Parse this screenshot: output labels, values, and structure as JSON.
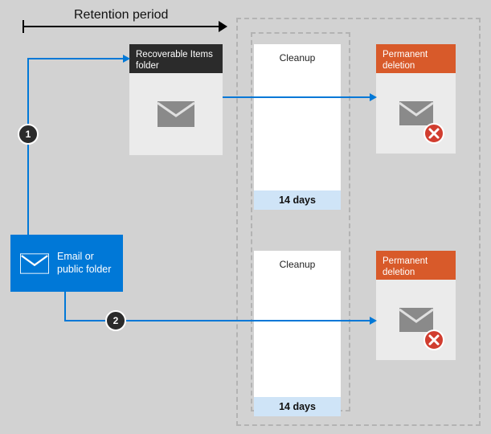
{
  "retentionPeriod": {
    "label": "Retention period"
  },
  "source": {
    "label": "Email or public folder"
  },
  "recoverable": {
    "label": "Recoverable Items folder"
  },
  "cleanup_top": {
    "label": "Cleanup",
    "duration": "14 days"
  },
  "cleanup_bottom": {
    "label": "Cleanup",
    "duration": "14 days"
  },
  "permanent_top": {
    "label": "Permanent deletion"
  },
  "permanent_bottom": {
    "label": "Permanent deletion"
  },
  "markers": {
    "one": "1",
    "two": "2"
  }
}
